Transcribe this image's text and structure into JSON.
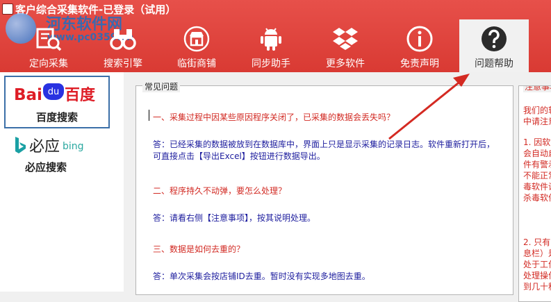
{
  "window": {
    "title": "客户综合采集软件-已登录（试用）"
  },
  "watermark": {
    "name": "河东软件网",
    "url": "www.pc0359.cn"
  },
  "nav": {
    "items": [
      {
        "label": "定向采集",
        "icon": "search-list-icon"
      },
      {
        "label": "搜索引擎",
        "icon": "binoculars-icon"
      },
      {
        "label": "临街商铺",
        "icon": "storefront-icon"
      },
      {
        "label": "同步助手",
        "icon": "android-icon"
      },
      {
        "label": "更多软件",
        "icon": "dropbox-icon"
      },
      {
        "label": "免责声明",
        "icon": "info-icon"
      },
      {
        "label": "问题帮助",
        "icon": "question-icon"
      }
    ],
    "active": "问题帮助"
  },
  "sidebar": {
    "baidu": {
      "logo_bai": "Bai",
      "logo_du": "du",
      "logo_cn": "百度",
      "label": "百度搜索"
    },
    "bing": {
      "logo_cn": "必应",
      "logo_en": "bing",
      "label": "必应搜索"
    }
  },
  "faq": {
    "title": "常见问题",
    "items": [
      {
        "q": "一、采集过程中因某些原因程序关闭了，已采集的数据会丢失吗？",
        "a": [
          "答：已经采集的数据被放到在数据库中，界面上只是显示采集的记录日志。软件重新打开后，",
          "可直接点击【导出Excel】按钮进行数据导出。"
        ]
      },
      {
        "q": "二、程序持久不动弹，要怎么处理？",
        "a": [
          "答：请看右侧【注意事项】，按其说明处理。"
        ]
      },
      {
        "q": "三、数据是如何去重的？",
        "a": [
          "答：单次采集会按店铺ID去重。暂时没有实现多地图去重。"
        ]
      }
    ]
  },
  "notice": {
    "title": "注意事项",
    "lines": [
      "我们的软",
      "中请注意",
      "1. 因软",
      "会自动启",
      "件有警示",
      "不能正常",
      "毒软件设",
      "杀毒软件",
      "2. 只有",
      "息栏）是",
      "处于工作",
      "处理操作",
      "到几十秒"
    ]
  },
  "colors": {
    "header": "#d93a33",
    "question": "#d22a23",
    "answer": "#1d1d9e",
    "arrow": "#d42a22"
  }
}
